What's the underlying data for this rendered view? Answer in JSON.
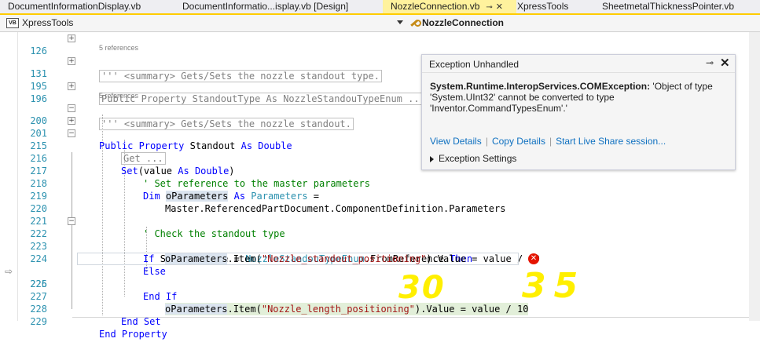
{
  "tabs": [
    {
      "label": "DocumentInformationDisplay.vb",
      "active": false
    },
    {
      "label": "DocumentInformatio...isplay.vb [Design]",
      "active": false
    },
    {
      "label": "NozzleConnection.vb",
      "active": true
    },
    {
      "label": "XpressTools",
      "active": false
    },
    {
      "label": "SheetmetalThicknessPointer.vb",
      "active": false
    }
  ],
  "navbar": {
    "project": "XpressTools",
    "class": "NozzleConnection"
  },
  "code": {
    "l126": "''' <summary> Gets/Sets the nozzle standout type.",
    "refs1": "5 references",
    "l131": "Public Property StandoutType As NozzleStandouTypeEnum ...",
    "l196": "''' <summary> Gets/Sets the nozzle standout.",
    "refs2": "5 references",
    "l200_kw1": "Public Property",
    "l200_rest": " Standout ",
    "l200_kw2": "As Double",
    "l201": "Get ...",
    "l215_kw": "Set",
    "l215_a": "(value ",
    "l215_kw2": "As Double",
    "l215_b": ")",
    "l217": "' Set reference to the master parameters",
    "l218_kw": "Dim ",
    "l218_var": "oParameters",
    "l218_as": " As ",
    "l218_ty": "Parameters",
    "l218_eq": " =",
    "l219": "Master.ReferencedPartDocument.ComponentDefinition.Parameters",
    "l221": "' Check the standout type",
    "l222_if": "If ",
    "l222_a": "StandoutType = ",
    "l222_ty": "NozzleStandouTypeEnum",
    "l222_b": ".FromReference ",
    "l222_then": "Then",
    "l223_var": "oParameters",
    "l223_a": ".Item(",
    "l223_str": "\"Nozzle_standout_positioning\"",
    "l223_b": ").Value = value / 10",
    "l224": "Else",
    "l225_var": "oParameters",
    "l225_a": ".Item(",
    "l225_str": "\"Nozzle_length_positioning\"",
    "l225_b": ").Value = value / 10",
    "l226": "End If",
    "l228": "End Set",
    "l229": "End Property"
  },
  "line_numbers": {
    "l126": "126",
    "l131": "131",
    "l195": "195",
    "l196": "196",
    "l200": "200",
    "l201": "201",
    "l215": "215",
    "l216": "216",
    "l217": "217",
    "l218": "218",
    "l219": "219",
    "l220": "220",
    "l221": "221",
    "l222": "222",
    "l223": "223",
    "l224": "224",
    "l225": "225",
    "l226": "226",
    "l227": "227",
    "l228": "228",
    "l229": "229"
  },
  "popup": {
    "title": "Exception Unhandled",
    "exception_type": "System.Runtime.InteropServices.COMException:",
    "message": " 'Object of type 'System.UInt32' cannot be converted to type 'Inventor.CommandTypesEnum'.'",
    "link_view": "View Details",
    "link_copy": "Copy Details",
    "link_share": "Start Live Share session...",
    "settings": "Exception Settings"
  },
  "annotations": {
    "left": "30",
    "right": "35"
  }
}
